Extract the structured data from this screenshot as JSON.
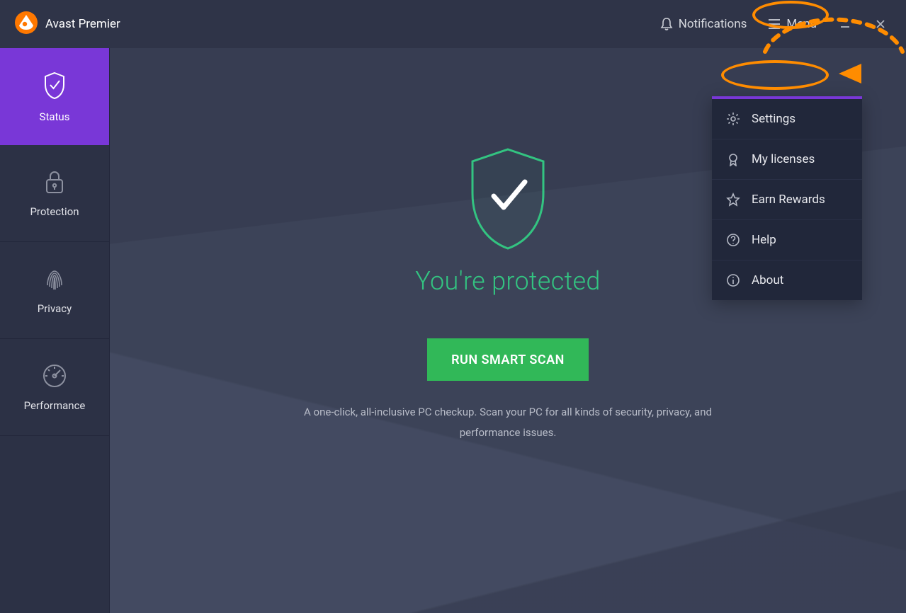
{
  "header": {
    "app_title": "Avast Premier",
    "notifications_label": "Notifications",
    "menu_label": "Menu"
  },
  "sidebar": {
    "items": [
      {
        "id": "status",
        "label": "Status",
        "icon": "shield-check-icon",
        "active": true
      },
      {
        "id": "protection",
        "label": "Protection",
        "icon": "lock-icon",
        "active": false
      },
      {
        "id": "privacy",
        "label": "Privacy",
        "icon": "fingerprint-icon",
        "active": false
      },
      {
        "id": "performance",
        "label": "Performance",
        "icon": "gauge-icon",
        "active": false
      }
    ]
  },
  "main": {
    "status_text": "You're protected",
    "scan_button_label": "RUN SMART SCAN",
    "sub_text": "A one-click, all-inclusive PC checkup. Scan your PC for all kinds of security, privacy, and performance issues."
  },
  "menu_dropdown": {
    "items": [
      {
        "id": "settings",
        "label": "Settings",
        "icon": "gear-icon"
      },
      {
        "id": "licenses",
        "label": "My licenses",
        "icon": "license-icon"
      },
      {
        "id": "rewards",
        "label": "Earn Rewards",
        "icon": "star-icon"
      },
      {
        "id": "help",
        "label": "Help",
        "icon": "question-circle-icon"
      },
      {
        "id": "about",
        "label": "About",
        "icon": "info-circle-icon"
      }
    ]
  },
  "colors": {
    "brand_orange": "#ff7800",
    "accent_purple": "#7937d7",
    "success_green": "#31b858",
    "annotation_orange": "#ff8c00"
  }
}
